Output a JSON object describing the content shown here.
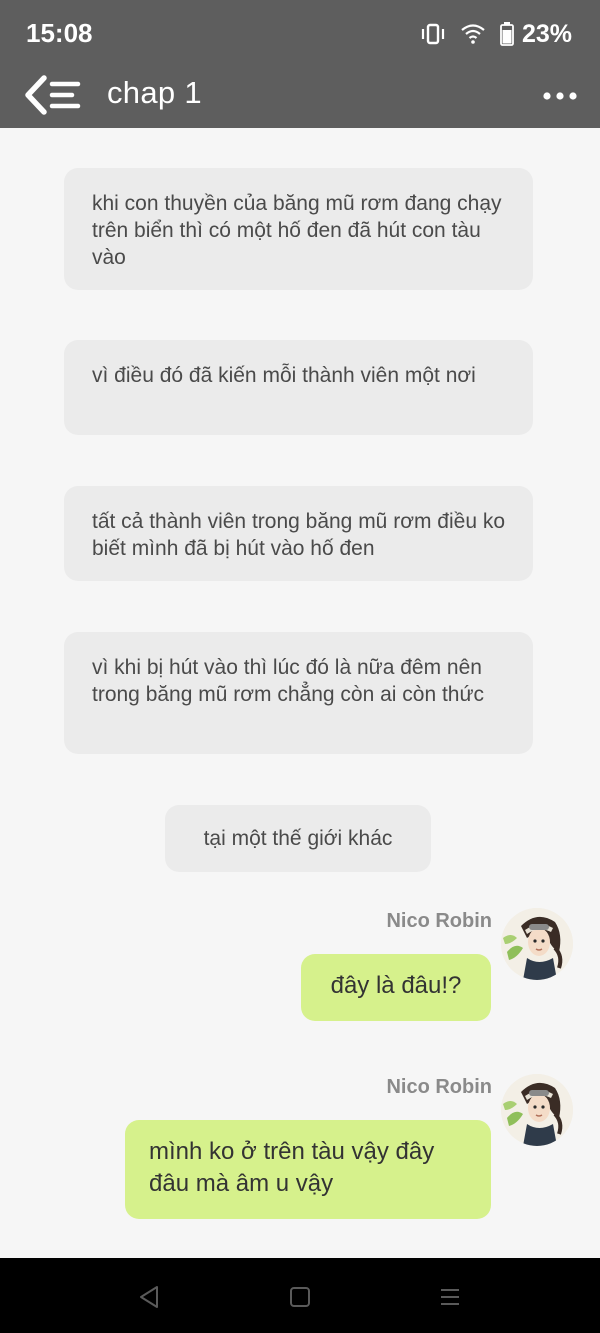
{
  "status_bar": {
    "time": "15:08",
    "battery": "23%",
    "icons": [
      "vibrate-icon",
      "wifi-icon",
      "battery-icon"
    ]
  },
  "app_bar": {
    "title": "chap 1",
    "back_icon": "back-menu-icon",
    "more_icon": "more-options-icon"
  },
  "chat": {
    "narrations": [
      "khi con thuyền của băng mũ rơm đang chạy trên biển thì có một hố đen đã hút con tàu vào",
      "vì điều đó đã kiến mỗi thành viên một nơi",
      "tất cả thành viên trong băng mũ rơm điều ko biết mình đã bị hút vào hố đen",
      "vì khi bị hút vào thì lúc đó là nữa đêm nên trong băng mũ rơm chẳng còn ai còn thức",
      "tại một thế giới khác"
    ],
    "messages": [
      {
        "speaker": "Nico Robin",
        "text": "đây là đâu!?"
      },
      {
        "speaker": "Nico Robin",
        "text": "mình ko ở trên tàu vậy đây đâu mà  âm u vậy"
      }
    ]
  },
  "colors": {
    "bar": "#5e5e5e",
    "narration_bg": "#ebebeb",
    "message_bg": "#d6f18c",
    "background": "#f6f6f6"
  },
  "nav_bar": {
    "icons": [
      "back-triangle-icon",
      "home-square-icon",
      "recents-menu-icon"
    ]
  }
}
